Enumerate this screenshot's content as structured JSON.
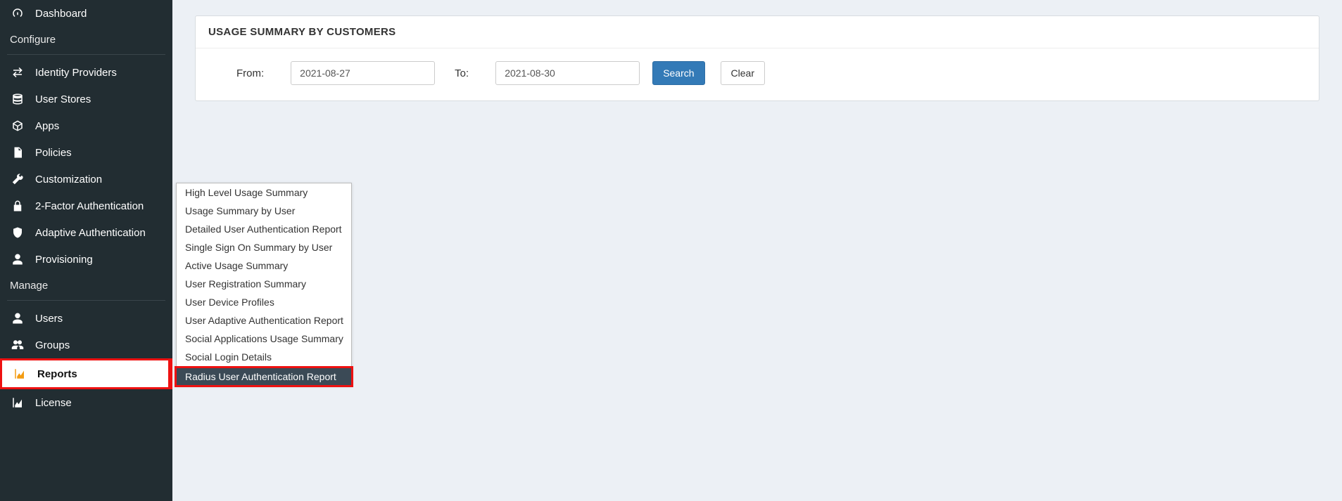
{
  "sidebar": {
    "items": [
      {
        "label": "Dashboard"
      },
      {
        "label": "Identity Providers"
      },
      {
        "label": "User Stores"
      },
      {
        "label": "Apps"
      },
      {
        "label": "Policies"
      },
      {
        "label": "Customization"
      },
      {
        "label": "2-Factor Authentication"
      },
      {
        "label": "Adaptive Authentication"
      },
      {
        "label": "Provisioning"
      },
      {
        "label": "Users"
      },
      {
        "label": "Groups"
      },
      {
        "label": "Reports"
      },
      {
        "label": "License"
      }
    ],
    "sections": {
      "configure": "Configure",
      "manage": "Manage"
    }
  },
  "submenu": {
    "items": [
      "High Level Usage Summary",
      "Usage Summary by User",
      "Detailed User Authentication Report",
      "Single Sign On Summary by User",
      "Active Usage Summary",
      "User Registration Summary",
      "User Device Profiles",
      "User Adaptive Authentication Report",
      "Social Applications Usage Summary",
      "Social Login Details",
      "Radius User Authentication Report"
    ]
  },
  "panel": {
    "title": "USAGE SUMMARY BY CUSTOMERS",
    "from_label": "From:",
    "to_label": "To:",
    "from_value": "2021-08-27",
    "to_value": "2021-08-30",
    "search_label": "Search",
    "clear_label": "Clear"
  }
}
